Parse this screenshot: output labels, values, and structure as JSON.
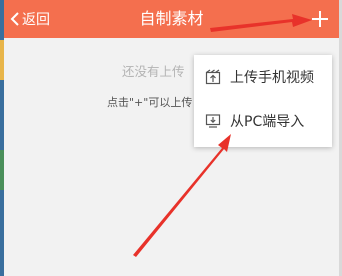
{
  "header": {
    "back_label": "返回",
    "title": "自制素材"
  },
  "empty_state": {
    "title": "还没有上传",
    "hint": "点击\"+\"可以上传"
  },
  "menu": {
    "items": [
      {
        "label": "上传手机视频",
        "icon": "upload-video-icon"
      },
      {
        "label": "从PC端导入",
        "icon": "pc-monitor-icon"
      }
    ]
  },
  "colors": {
    "header_bg": "#f46f4e",
    "annotation_arrow": "#e8322a",
    "background": "#f2f2f2"
  }
}
